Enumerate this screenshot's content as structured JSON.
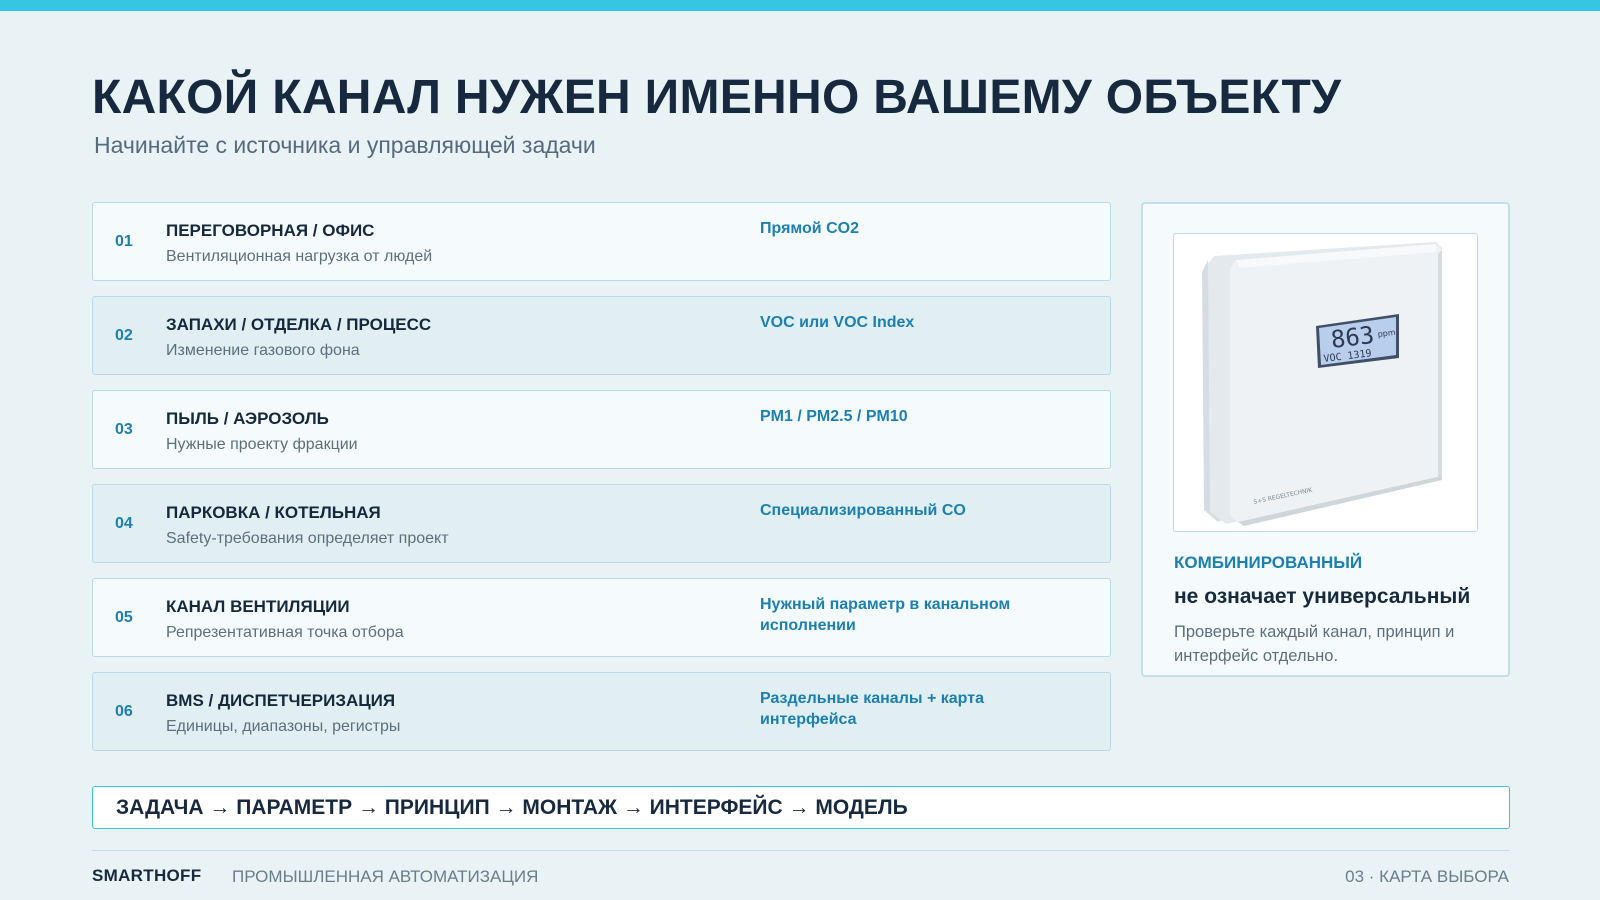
{
  "colors": {
    "accent_bar": "#36c5e3",
    "accent_text": "#1c7fb2",
    "heading": "#17293e",
    "background": "#e9f3f6"
  },
  "header": {
    "title": "КАКОЙ КАНАЛ НУЖЕН ИМЕННО ВАШЕМУ ОБЪЕКТУ",
    "subtitle": "Начинайте с источника и управляющей задачи"
  },
  "rows": [
    {
      "num": "01",
      "title": "ПЕРЕГОВОРНАЯ / ОФИС",
      "desc": "Вентиляционная нагрузка от людей",
      "result": "Прямой CO2"
    },
    {
      "num": "02",
      "title": "ЗАПАХИ / ОТДЕЛКА / ПРОЦЕСС",
      "desc": "Изменение газового фона",
      "result": "VOC или VOC Index"
    },
    {
      "num": "03",
      "title": "ПЫЛЬ / АЭРОЗОЛЬ",
      "desc": "Нужные проекту фракции",
      "result": "PM1 / PM2.5 / PM10"
    },
    {
      "num": "04",
      "title": "ПАРКОВКА / КОТЕЛЬНАЯ",
      "desc": "Safety-требования определяет проект",
      "result": "Специализированный CO"
    },
    {
      "num": "05",
      "title": "КАНАЛ ВЕНТИЛЯЦИИ",
      "desc": "Репрезентативная точка отбора",
      "result": "Нужный параметр в канальном исполнении"
    },
    {
      "num": "06",
      "title": "BMS / ДИСПЕТЧЕРИЗАЦИЯ",
      "desc": "Единицы, диапазоны, регистры",
      "result": "Раздельные каналы + карта интерфейса"
    }
  ],
  "side_card": {
    "device_display": {
      "value": "863",
      "unit": "ppm",
      "second_line": "VOC 1319"
    },
    "device_brand": "S+S REGELTECHNIK",
    "label": "КОМБИНИРОВАННЫЙ",
    "heading": "не означает универсальный",
    "text": "Проверьте каждый канал, принцип и интерфейс отдельно."
  },
  "flow": "ЗАДАЧА → ПАРАМЕТР → ПРИНЦИП → МОНТАЖ → ИНТЕРФЕЙС → МОДЕЛЬ",
  "footer": {
    "brand": "SMARTHOFF",
    "tagline": "ПРОМЫШЛЕННАЯ АВТОМАТИЗАЦИЯ",
    "page_label": "03 · КАРТА ВЫБОРА"
  }
}
